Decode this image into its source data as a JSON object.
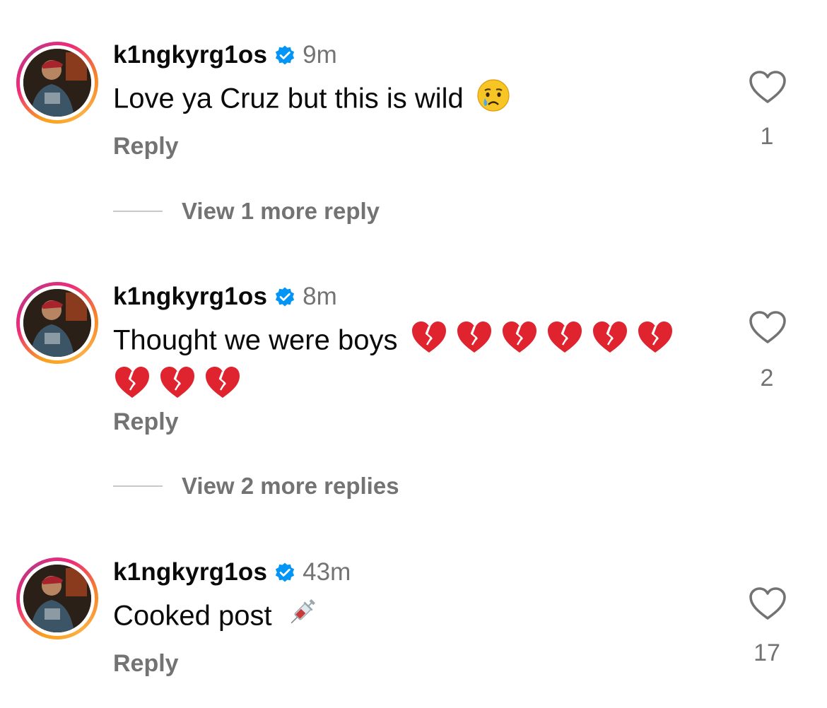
{
  "comments": [
    {
      "username": "k1ngkyrg1os",
      "time": "9m",
      "text": "Love ya Cruz but this is wild",
      "emojis": [
        "crying-face"
      ],
      "reply_label": "Reply",
      "like_count": "1",
      "view_more": "View 1 more reply"
    },
    {
      "username": "k1ngkyrg1os",
      "time": "8m",
      "text": "Thought we were boys",
      "emojis": [
        "broken-heart",
        "broken-heart",
        "broken-heart",
        "broken-heart",
        "broken-heart",
        "broken-heart",
        "broken-heart",
        "broken-heart",
        "broken-heart"
      ],
      "reply_label": "Reply",
      "like_count": "2",
      "view_more": "View 2 more replies"
    },
    {
      "username": "k1ngkyrg1os",
      "time": "43m",
      "text": "Cooked post",
      "emojis": [
        "syringe"
      ],
      "reply_label": "Reply",
      "like_count": "17"
    }
  ],
  "colors": {
    "verified": "#0095f6",
    "secondary_text": "#737373",
    "broken_heart": "#e0242f"
  }
}
